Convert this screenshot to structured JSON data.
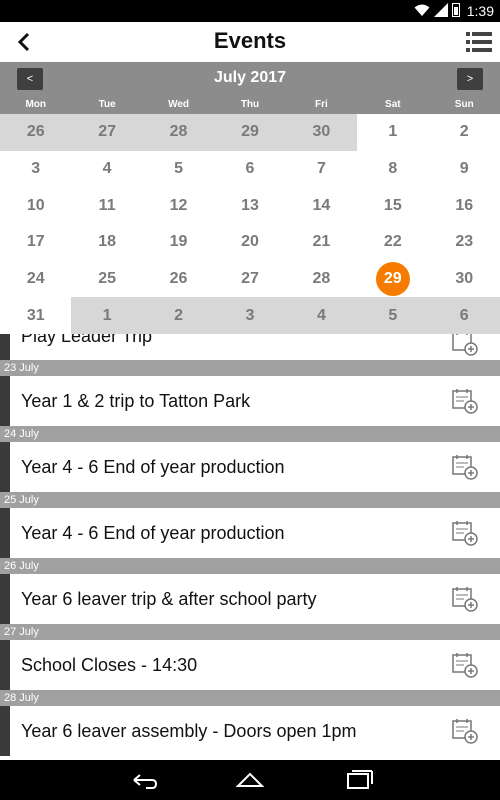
{
  "status_bar": {
    "time": "1:39",
    "icons": [
      "wifi-icon",
      "signal-icon",
      "battery-icon"
    ]
  },
  "app_bar": {
    "title": "Events",
    "back_icon": "back-arrow-icon",
    "list_icon": "list-view-icon"
  },
  "calendar": {
    "month_label": "July 2017",
    "prev_label": "<",
    "next_label": ">",
    "weekdays": [
      "Mon",
      "Tue",
      "Wed",
      "Thu",
      "Fri",
      "Sat",
      "Sun"
    ],
    "weeks": [
      [
        {
          "d": "26",
          "other": true
        },
        {
          "d": "27",
          "other": true
        },
        {
          "d": "28",
          "other": true
        },
        {
          "d": "29",
          "other": true
        },
        {
          "d": "30",
          "other": true
        },
        {
          "d": "1"
        },
        {
          "d": "2"
        }
      ],
      [
        {
          "d": "3"
        },
        {
          "d": "4"
        },
        {
          "d": "5"
        },
        {
          "d": "6"
        },
        {
          "d": "7"
        },
        {
          "d": "8"
        },
        {
          "d": "9"
        }
      ],
      [
        {
          "d": "10"
        },
        {
          "d": "11"
        },
        {
          "d": "12"
        },
        {
          "d": "13"
        },
        {
          "d": "14"
        },
        {
          "d": "15"
        },
        {
          "d": "16"
        }
      ],
      [
        {
          "d": "17"
        },
        {
          "d": "18"
        },
        {
          "d": "19"
        },
        {
          "d": "20"
        },
        {
          "d": "21"
        },
        {
          "d": "22"
        },
        {
          "d": "23"
        }
      ],
      [
        {
          "d": "24"
        },
        {
          "d": "25"
        },
        {
          "d": "26"
        },
        {
          "d": "27"
        },
        {
          "d": "28"
        },
        {
          "d": "29",
          "selected": true
        },
        {
          "d": "30"
        }
      ],
      [
        {
          "d": "31"
        },
        {
          "d": "1",
          "other": true
        },
        {
          "d": "2",
          "other": true
        },
        {
          "d": "3",
          "other": true
        },
        {
          "d": "4",
          "other": true
        },
        {
          "d": "5",
          "other": true
        },
        {
          "d": "6",
          "other": true
        }
      ]
    ],
    "selected_color": "#f57c00"
  },
  "events": {
    "partial_first": "Play Leader Trip",
    "groups": [
      {
        "date": "23 July",
        "title": "Year 1 & 2 trip to Tatton Park"
      },
      {
        "date": "24 July",
        "title": "Year 4 - 6 End of year production"
      },
      {
        "date": "25 July",
        "title": "Year 4 - 6 End of year production"
      },
      {
        "date": "26 July",
        "title": "Year 6 leaver trip & after school party"
      },
      {
        "date": "27 July",
        "title": "School Closes - 14:30"
      },
      {
        "date": "28 July",
        "title": "Year 6 leaver assembly - Doors open 1pm"
      }
    ],
    "add_icon": "calendar-add-icon"
  },
  "nav_bar": {
    "icons": [
      "nav-back-icon",
      "nav-home-icon",
      "nav-recent-apps-icon"
    ]
  }
}
